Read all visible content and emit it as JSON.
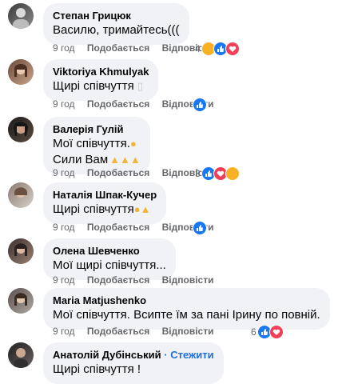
{
  "comments": [
    {
      "author": "Степан Грицюк",
      "follow": "",
      "lines": [
        "Василю, тримайтесь((("
      ],
      "time": "9 год",
      "like": "Подобається",
      "reply": "Відповісти",
      "reaction_count": "4"
    },
    {
      "author": "Viktoriya Khmulyak",
      "follow": "",
      "lines": [
        "Щирі співчуття"
      ],
      "time": "9 год",
      "like": "Подобається",
      "reply": "Відповісти",
      "reaction_count": ""
    },
    {
      "author": "Валерія Гулій",
      "follow": "",
      "lines": [
        "Мої співчуття.",
        "Сили Вам"
      ],
      "time": "9 год",
      "like": "Подобається",
      "reply": "Відповісти",
      "reaction_count": "3"
    },
    {
      "author": "Наталія Шпак-Кучер",
      "follow": "",
      "lines": [
        "Щирі співчуття"
      ],
      "time": "9 год",
      "like": "Подобається",
      "reply": "Відповісти",
      "reaction_count": ""
    },
    {
      "author": "Олена Шевченко",
      "follow": "",
      "lines": [
        "Мої щирі співчуття..."
      ],
      "time": "9 год",
      "like": "Подобається",
      "reply": "Відповісти",
      "reaction_count": ""
    },
    {
      "author": "Maria Matjushenko",
      "follow": "",
      "lines": [
        "Мої співчуття. Всипте їм за пані Ірину по повній."
      ],
      "time": "9 год",
      "like": "Подобається",
      "reply": "Відповісти",
      "reaction_count": "6"
    },
    {
      "author": "Анатолій Дубінський",
      "follow": "· Стежити",
      "lines": [
        "Щирі співчуття !"
      ],
      "time": "",
      "like": "",
      "reply": "",
      "reaction_count": ""
    }
  ],
  "colors": {
    "bubble": "#f0f2f5",
    "link": "#216fdb",
    "meta": "#65676b",
    "like": "#1877f2",
    "love": "#f33e58"
  }
}
